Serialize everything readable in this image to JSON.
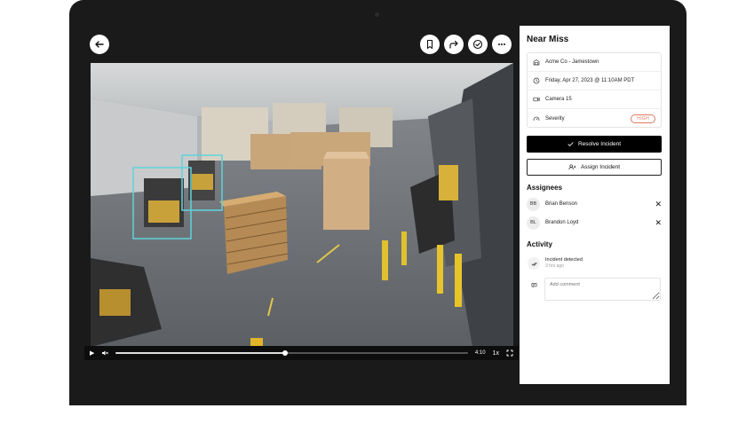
{
  "toolbar": {
    "back_icon": "arrow-left-icon",
    "bookmark_icon": "bookmark-icon",
    "share_icon": "share-arrow-icon",
    "check_icon": "check-circle-icon",
    "more_icon": "more-horizontal-icon"
  },
  "video": {
    "progress_fraction": 0.48,
    "time": "4:10",
    "speed": "1x"
  },
  "panel": {
    "title": "Near Miss",
    "info": {
      "site": "Acme Co - Jamestown",
      "datetime": "Friday, Apr 27, 2023 @ 11:10AM PDT",
      "camera": "Camera 15",
      "severity_label": "Severity",
      "severity_value": "HIGH"
    },
    "resolve_label": "Resolve Incident",
    "assign_label": "Assign Incident",
    "assignees_heading": "Assignees",
    "assignees": [
      {
        "initials": "BB",
        "name": "Brian Benson"
      },
      {
        "initials": "BL",
        "name": "Brandon Loyd"
      }
    ],
    "activity_heading": "Activity",
    "activity_event": "Incident detected",
    "activity_time": "3 hrs ago",
    "comment_placeholder": "Add comment"
  },
  "colors": {
    "severity": "#e07a5f",
    "detection_box": "#5fd3dc",
    "primary_button": "#000000"
  }
}
